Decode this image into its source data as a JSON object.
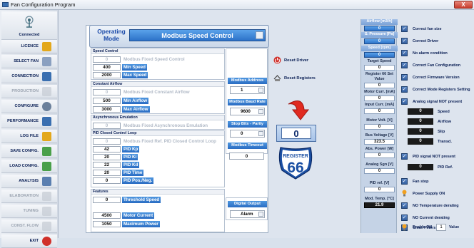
{
  "window": {
    "title": "Fan Configuration Program",
    "close": "X"
  },
  "sidebar": {
    "connected": "Connected",
    "items": [
      {
        "label": "LICENCE",
        "icon": "folder-lock-icon",
        "disabled": false
      },
      {
        "label": "SELECT FAN",
        "icon": "fan-icon",
        "disabled": false
      },
      {
        "label": "CONNECTION",
        "icon": "monitor-icon",
        "disabled": false
      },
      {
        "label": "PRODUCTION",
        "icon": "wrench-icon",
        "disabled": true
      },
      {
        "label": "CONFIGURE",
        "icon": "gear-icon",
        "disabled": false
      },
      {
        "label": "PERFORMANCE",
        "icon": "gauge-icon",
        "disabled": false
      },
      {
        "label": "LOG FILE",
        "icon": "folder-icon",
        "disabled": false
      },
      {
        "label": "SAVE CONFIG.",
        "icon": "save-icon",
        "disabled": false
      },
      {
        "label": "LOAD CONFIG.",
        "icon": "load-icon",
        "disabled": false
      },
      {
        "label": "ANALYSIS",
        "icon": "magnifier-icon",
        "disabled": false
      },
      {
        "label": "ELABORATION",
        "icon": "chart-icon",
        "disabled": true
      },
      {
        "label": "TUNING",
        "icon": "tuning-icon",
        "disabled": true
      },
      {
        "label": "CONST. FLOW",
        "icon": "flow-icon",
        "disabled": true
      },
      {
        "label": "EXIT",
        "icon": "exit-icon",
        "disabled": false
      }
    ]
  },
  "opmode": {
    "label": "Operating Mode",
    "value": "Modbus Speed Control"
  },
  "speed_control": {
    "title": "Speed Control",
    "rows": [
      {
        "value": "0",
        "label": "Modbus Fixed Speed Control",
        "disabled": true
      },
      {
        "value": "400",
        "label": "Min Speed",
        "disabled": false
      },
      {
        "value": "2000",
        "label": "Max Speed",
        "disabled": false
      }
    ]
  },
  "constant_airflow": {
    "title": "Constant Airflow",
    "rows": [
      {
        "value": "0",
        "label": "Modbus Fixed Constant Airflow",
        "disabled": true
      },
      {
        "value": "500",
        "label": "Min Airflow",
        "disabled": false
      },
      {
        "value": "3000",
        "label": "Max Airflow",
        "disabled": false
      }
    ]
  },
  "async_emulation": {
    "title": "Asynchronous Emulation",
    "rows": [
      {
        "value": "0",
        "label": "Modbus Fixed Asynchronous Emulation",
        "disabled": true
      }
    ]
  },
  "pid": {
    "title": "PID Closed Control Loop",
    "rows": [
      {
        "value": "0",
        "label": "Modbus Fixed Ref. PID Closed Control Loop",
        "disabled": true
      },
      {
        "value": "42",
        "label": "PID Kp",
        "disabled": false
      },
      {
        "value": "20",
        "label": "PID Ki",
        "disabled": false
      },
      {
        "value": "22",
        "label": "PID Kd",
        "disabled": false
      },
      {
        "value": "20",
        "label": "PID Time",
        "disabled": false
      },
      {
        "value": "0",
        "label": "PID Pos./Neg.",
        "disabled": false
      }
    ]
  },
  "features": {
    "title": "Features",
    "rows": [
      {
        "value": "0",
        "label": "Threshold Speed",
        "disabled": false
      },
      {
        "value": "4500",
        "label": "Motor Current",
        "disabled": false
      },
      {
        "value": "1050",
        "label": "Maximum Power",
        "disabled": false
      }
    ]
  },
  "modbus": {
    "address_label": "Modbus Address",
    "address": "1",
    "baud_label": "Modbus Baud Rate",
    "baud": "9600",
    "stopbits_label": "Stop Bits - Parity",
    "stopbits": "0",
    "timeout_label": "Modbus Timeout",
    "timeout": "0"
  },
  "digital_output": {
    "label": "Digital Output",
    "value": "Alarm"
  },
  "actions": {
    "reset_driver": "Reset Driver",
    "reset_registers": "Reset Registers"
  },
  "register": {
    "value": "0",
    "sign_top": "REGISTER",
    "sign_num": "66"
  },
  "stats": {
    "airflow_label": "Airflow [m3/h]",
    "airflow": "0",
    "spressure_label": "S. Pressure [Pa]",
    "spressure": "0",
    "speed_label": "Speed [rpm]",
    "speed": "0",
    "target_label": "Target Speed",
    "target": "0",
    "reg66_label": "Register 66 Set Value",
    "reg66": "0",
    "motorcurr_label": "Motor Curr. [mA]",
    "motorcurr": "0",
    "inputcurr_label": "Input Curr. [mA]",
    "inputcurr": "0",
    "motorvolt_label": "Motor Volt. [V]",
    "motorvolt": "0",
    "busvolt_label": "Bus Voltage [V]",
    "busvolt": "323.5",
    "abspower_label": "Abs. Power [W]",
    "abspower": "0",
    "analogsgn_label": "Analog Sgn [V]",
    "analogsgn": "0",
    "pidref_label": "PID ref. [V]",
    "pidref": "0",
    "modtemp_label": "Mod. Temp. [°C]",
    "modtemp": "21.9"
  },
  "checks": {
    "fan_size": "Correct fan size",
    "driver": "Correct Driver",
    "no_alarm": "No alarm condition",
    "fan_config": "Correct Fan Configuration",
    "firmware": "Correct Firmware Version",
    "mode_regs": "Correct Mode Registers Setting",
    "analog_signal": "Analog signal NOT present",
    "speed_val": "0",
    "speed_lbl": "Speed",
    "airflow_val": "0",
    "airflow_lbl": "Airflow",
    "slip_val": "0",
    "slip_lbl": "Slip",
    "transd_val": "0",
    "transd_lbl": "Transd.",
    "pid_signal": "PID signal NOT present",
    "pidref_val": "0",
    "pidref_lbl": "PID Ref.",
    "fan_stop": "Fan stop",
    "power_supply": "Power Supply ON",
    "no_temp": "NO Temperature derating",
    "no_current": "NO Current derating",
    "clean_filters": "Clean Filters",
    "enable_on": "Enable ON",
    "enable_val": "1",
    "enable_value_lbl": "Value"
  }
}
